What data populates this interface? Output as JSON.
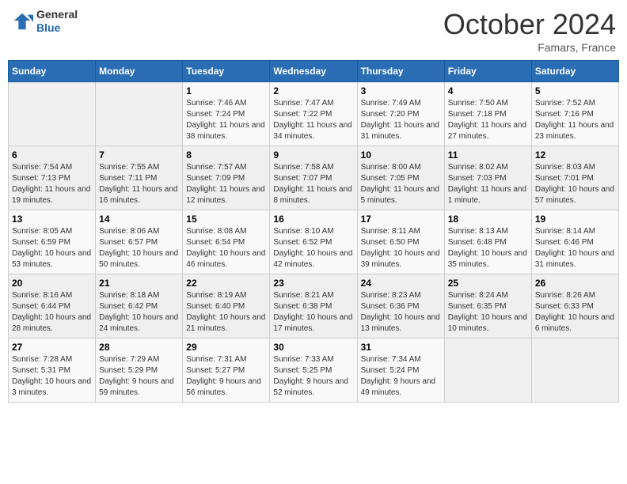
{
  "header": {
    "logo_line1": "General",
    "logo_line2": "Blue",
    "month": "October 2024",
    "location": "Famars, France"
  },
  "days_of_week": [
    "Sunday",
    "Monday",
    "Tuesday",
    "Wednesday",
    "Thursday",
    "Friday",
    "Saturday"
  ],
  "weeks": [
    [
      {
        "day": "",
        "sunrise": "",
        "sunset": "",
        "daylight": ""
      },
      {
        "day": "",
        "sunrise": "",
        "sunset": "",
        "daylight": ""
      },
      {
        "day": "1",
        "sunrise": "Sunrise: 7:46 AM",
        "sunset": "Sunset: 7:24 PM",
        "daylight": "Daylight: 11 hours and 38 minutes."
      },
      {
        "day": "2",
        "sunrise": "Sunrise: 7:47 AM",
        "sunset": "Sunset: 7:22 PM",
        "daylight": "Daylight: 11 hours and 34 minutes."
      },
      {
        "day": "3",
        "sunrise": "Sunrise: 7:49 AM",
        "sunset": "Sunset: 7:20 PM",
        "daylight": "Daylight: 11 hours and 31 minutes."
      },
      {
        "day": "4",
        "sunrise": "Sunrise: 7:50 AM",
        "sunset": "Sunset: 7:18 PM",
        "daylight": "Daylight: 11 hours and 27 minutes."
      },
      {
        "day": "5",
        "sunrise": "Sunrise: 7:52 AM",
        "sunset": "Sunset: 7:16 PM",
        "daylight": "Daylight: 11 hours and 23 minutes."
      }
    ],
    [
      {
        "day": "6",
        "sunrise": "Sunrise: 7:54 AM",
        "sunset": "Sunset: 7:13 PM",
        "daylight": "Daylight: 11 hours and 19 minutes."
      },
      {
        "day": "7",
        "sunrise": "Sunrise: 7:55 AM",
        "sunset": "Sunset: 7:11 PM",
        "daylight": "Daylight: 11 hours and 16 minutes."
      },
      {
        "day": "8",
        "sunrise": "Sunrise: 7:57 AM",
        "sunset": "Sunset: 7:09 PM",
        "daylight": "Daylight: 11 hours and 12 minutes."
      },
      {
        "day": "9",
        "sunrise": "Sunrise: 7:58 AM",
        "sunset": "Sunset: 7:07 PM",
        "daylight": "Daylight: 11 hours and 8 minutes."
      },
      {
        "day": "10",
        "sunrise": "Sunrise: 8:00 AM",
        "sunset": "Sunset: 7:05 PM",
        "daylight": "Daylight: 11 hours and 5 minutes."
      },
      {
        "day": "11",
        "sunrise": "Sunrise: 8:02 AM",
        "sunset": "Sunset: 7:03 PM",
        "daylight": "Daylight: 11 hours and 1 minute."
      },
      {
        "day": "12",
        "sunrise": "Sunrise: 8:03 AM",
        "sunset": "Sunset: 7:01 PM",
        "daylight": "Daylight: 10 hours and 57 minutes."
      }
    ],
    [
      {
        "day": "13",
        "sunrise": "Sunrise: 8:05 AM",
        "sunset": "Sunset: 6:59 PM",
        "daylight": "Daylight: 10 hours and 53 minutes."
      },
      {
        "day": "14",
        "sunrise": "Sunrise: 8:06 AM",
        "sunset": "Sunset: 6:57 PM",
        "daylight": "Daylight: 10 hours and 50 minutes."
      },
      {
        "day": "15",
        "sunrise": "Sunrise: 8:08 AM",
        "sunset": "Sunset: 6:54 PM",
        "daylight": "Daylight: 10 hours and 46 minutes."
      },
      {
        "day": "16",
        "sunrise": "Sunrise: 8:10 AM",
        "sunset": "Sunset: 6:52 PM",
        "daylight": "Daylight: 10 hours and 42 minutes."
      },
      {
        "day": "17",
        "sunrise": "Sunrise: 8:11 AM",
        "sunset": "Sunset: 6:50 PM",
        "daylight": "Daylight: 10 hours and 39 minutes."
      },
      {
        "day": "18",
        "sunrise": "Sunrise: 8:13 AM",
        "sunset": "Sunset: 6:48 PM",
        "daylight": "Daylight: 10 hours and 35 minutes."
      },
      {
        "day": "19",
        "sunrise": "Sunrise: 8:14 AM",
        "sunset": "Sunset: 6:46 PM",
        "daylight": "Daylight: 10 hours and 31 minutes."
      }
    ],
    [
      {
        "day": "20",
        "sunrise": "Sunrise: 8:16 AM",
        "sunset": "Sunset: 6:44 PM",
        "daylight": "Daylight: 10 hours and 28 minutes."
      },
      {
        "day": "21",
        "sunrise": "Sunrise: 8:18 AM",
        "sunset": "Sunset: 6:42 PM",
        "daylight": "Daylight: 10 hours and 24 minutes."
      },
      {
        "day": "22",
        "sunrise": "Sunrise: 8:19 AM",
        "sunset": "Sunset: 6:40 PM",
        "daylight": "Daylight: 10 hours and 21 minutes."
      },
      {
        "day": "23",
        "sunrise": "Sunrise: 8:21 AM",
        "sunset": "Sunset: 6:38 PM",
        "daylight": "Daylight: 10 hours and 17 minutes."
      },
      {
        "day": "24",
        "sunrise": "Sunrise: 8:23 AM",
        "sunset": "Sunset: 6:36 PM",
        "daylight": "Daylight: 10 hours and 13 minutes."
      },
      {
        "day": "25",
        "sunrise": "Sunrise: 8:24 AM",
        "sunset": "Sunset: 6:35 PM",
        "daylight": "Daylight: 10 hours and 10 minutes."
      },
      {
        "day": "26",
        "sunrise": "Sunrise: 8:26 AM",
        "sunset": "Sunset: 6:33 PM",
        "daylight": "Daylight: 10 hours and 6 minutes."
      }
    ],
    [
      {
        "day": "27",
        "sunrise": "Sunrise: 7:28 AM",
        "sunset": "Sunset: 5:31 PM",
        "daylight": "Daylight: 10 hours and 3 minutes."
      },
      {
        "day": "28",
        "sunrise": "Sunrise: 7:29 AM",
        "sunset": "Sunset: 5:29 PM",
        "daylight": "Daylight: 9 hours and 59 minutes."
      },
      {
        "day": "29",
        "sunrise": "Sunrise: 7:31 AM",
        "sunset": "Sunset: 5:27 PM",
        "daylight": "Daylight: 9 hours and 56 minutes."
      },
      {
        "day": "30",
        "sunrise": "Sunrise: 7:33 AM",
        "sunset": "Sunset: 5:25 PM",
        "daylight": "Daylight: 9 hours and 52 minutes."
      },
      {
        "day": "31",
        "sunrise": "Sunrise: 7:34 AM",
        "sunset": "Sunset: 5:24 PM",
        "daylight": "Daylight: 9 hours and 49 minutes."
      },
      {
        "day": "",
        "sunrise": "",
        "sunset": "",
        "daylight": ""
      },
      {
        "day": "",
        "sunrise": "",
        "sunset": "",
        "daylight": ""
      }
    ]
  ]
}
